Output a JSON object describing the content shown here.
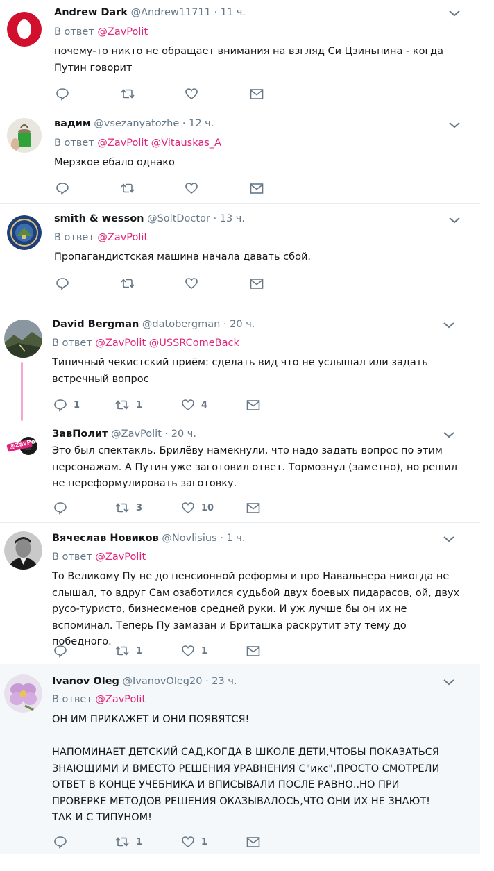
{
  "colors": {
    "mention": "#e0247a",
    "meta": "#657786",
    "divider": "#e6ecf0",
    "thread_line": "#f2a8d0"
  },
  "tweets": [
    {
      "name": "Andrew Dark",
      "handle": "@Andrew11711",
      "time": "· 11 ч.",
      "reply_label": "В ответ",
      "mentions": [
        "@ZavPolit"
      ],
      "text": [
        "почему-то никто не обращает внимания на взгляд Си Цзиньпина - когда",
        "Путин говорит"
      ],
      "counts": {
        "replies": "",
        "retweets": "",
        "likes": ""
      },
      "avatar": "opera-logo-avatar"
    },
    {
      "name": "вадим",
      "handle": "@vsezanyatozhe",
      "time": "· 12 ч.",
      "reply_label": "В ответ",
      "mentions": [
        "@ZavPolit",
        "@Vitauskas_A"
      ],
      "text": [
        "Мерзкое ебало однако"
      ],
      "counts": {
        "replies": "",
        "retweets": "",
        "likes": ""
      },
      "avatar": "green-cup-avatar"
    },
    {
      "name": "smith & wesson",
      "handle": "@SoltDoctor",
      "time": "· 13 ч.",
      "reply_label": "В ответ",
      "mentions": [
        "@ZavPolit"
      ],
      "text": [
        "Пропагандистская машина начала давать сбой."
      ],
      "counts": {
        "replies": "",
        "retweets": "",
        "likes": ""
      },
      "avatar": "state-seal-avatar"
    },
    {
      "name": "David Bergman",
      "handle": "@datobergman",
      "time": "· 20 ч.",
      "reply_label": "В ответ",
      "mentions": [
        "@ZavPolit",
        "@USSRComeBack"
      ],
      "text": [
        "Типичный чекистский приём: сделать вид что не услышал или задать",
        "встречный вопрос"
      ],
      "counts": {
        "replies": "1",
        "retweets": "1",
        "likes": "4"
      },
      "avatar": "landscape-avatar"
    },
    {
      "name": "ЗавПолит",
      "handle": "@ZavPolit",
      "time": "· 20 ч.",
      "reply_label": "",
      "mentions": [],
      "text": [
        "Это был спектакль. Брилёву намекнули, что надо задать вопрос по этим",
        "персонажам. А Путин уже заготовил ответ. Тормознул (заметно), но решил",
        "не переформулировать заготовку."
      ],
      "counts": {
        "replies": "",
        "retweets": "3",
        "likes": "10"
      },
      "avatar": "zavpolit-logo-avatar",
      "avatar_text": "@ZavPolit"
    },
    {
      "name": "Вячеслав Новиков",
      "handle": "@Novlisius",
      "time": "· 1 ч.",
      "reply_label": "В ответ",
      "mentions": [
        "@ZavPolit"
      ],
      "text": [
        "То Великому Пу не до пенсионной реформы и про Навальнера никогда не",
        "слышал, то вдруг Сам озаботился судьбой двух боевых пидарасов, ой, двух",
        "русо-туристо, бизнесменов средней руки. И уж лучше бы он их не",
        "вспоминал. Теперь Пу замазан и Бриташка раскрутит эту тему до победного."
      ],
      "counts": {
        "replies": "",
        "retweets": "1",
        "likes": "1"
      },
      "avatar": "portrait-avatar"
    },
    {
      "name": "Ivanov Oleg",
      "handle": "@IvanovOleg20",
      "time": "· 23 ч.",
      "reply_label": "В ответ",
      "mentions": [
        "@ZavPolit"
      ],
      "text": [
        "ОН ИМ ПРИКАЖЕТ И ОНИ ПОЯВЯТСЯ!",
        "",
        "НАПОМИНАЕТ ДЕТСКИЙ САД,КОГДА В ШКОЛЕ ДЕТИ,ЧТОБЫ ПОКАЗАТЬСЯ",
        "ЗНАЮЩИМИ И ВМЕСТО РЕШЕНИЯ УРАВНЕНИЯ С\"икс\",ПРОСТО СМОТРЕЛИ",
        "ОТВЕТ В КОНЦЕ УЧЕБНИКА И ВПИСЫВАЛИ ПОСЛЕ РАВНО..НО ПРИ",
        "ПРОВЕРКЕ МЕТОДОВ РЕШЕНИЯ ОКАЗЫВАЛОСЬ,ЧТО ОНИ ИХ НЕ ЗНАЮТ!",
        "ТАК И С ТИПУНОМ!"
      ],
      "counts": {
        "replies": "",
        "retweets": "1",
        "likes": "1"
      },
      "avatar": "flower-avatar"
    }
  ]
}
